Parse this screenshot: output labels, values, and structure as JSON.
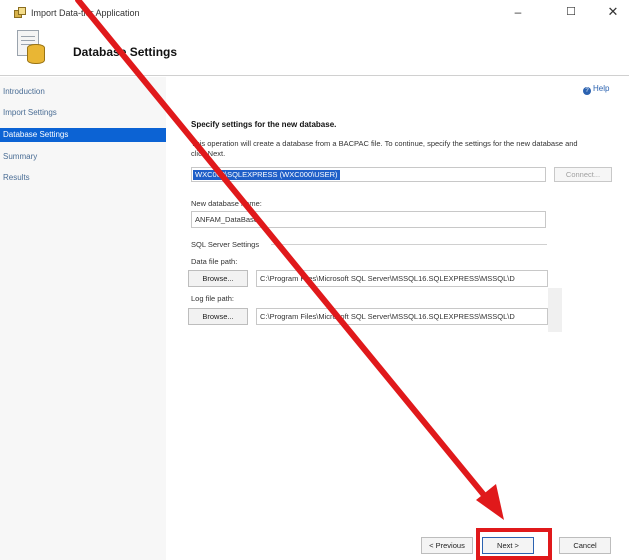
{
  "window": {
    "title": "Import Data-tier Application",
    "controls": {
      "minimize": "–",
      "maximize": "☐",
      "close": "✕"
    }
  },
  "header": {
    "title": "Database Settings"
  },
  "nav": {
    "items": [
      {
        "label": "Introduction",
        "active": false
      },
      {
        "label": "Import Settings",
        "active": false
      },
      {
        "label": "Database Settings",
        "active": true
      },
      {
        "label": "Summary",
        "active": false
      },
      {
        "label": "Results",
        "active": false
      }
    ]
  },
  "help": {
    "label": "Help"
  },
  "content": {
    "heading": "Specify settings for the new database.",
    "description": "This operation will create a database from a BACPAC file. To continue, specify the settings for the new database and click Next.",
    "server": {
      "value": "WXC000\\SQLEXPRESS (WXC000\\USER)",
      "connect_label": "Connect..."
    },
    "db_name": {
      "label": "New database name:",
      "value": "ANFAM_DataBase"
    },
    "sql_settings": {
      "group_label": "SQL Server Settings",
      "data_file": {
        "label": "Data file path:",
        "browse_label": "Browse...",
        "value": "C:\\Program Files\\Microsoft SQL Server\\MSSQL16.SQLEXPRESS\\MSSQL\\D"
      },
      "log_file": {
        "label": "Log file path:",
        "browse_label": "Browse...",
        "value": "C:\\Program Files\\Microsoft SQL Server\\MSSQL16.SQLEXPRESS\\MSSQL\\D"
      }
    }
  },
  "footer": {
    "previous": "< Previous",
    "next": "Next >",
    "cancel": "Cancel"
  },
  "annotation": {
    "color": "#e0191b"
  },
  "icons": [
    "app-icon",
    "database-settings-icon",
    "help-icon",
    "minimize-icon",
    "maximize-icon",
    "close-icon"
  ]
}
